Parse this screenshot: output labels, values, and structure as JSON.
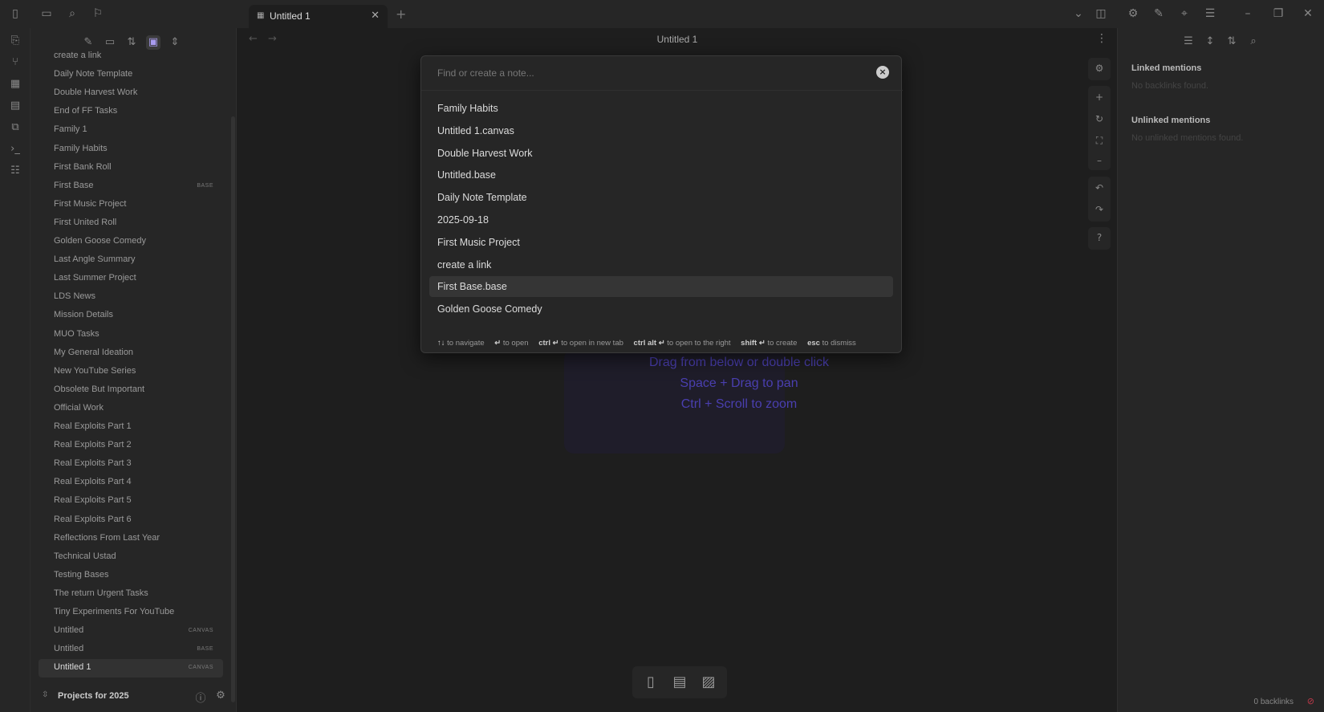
{
  "tabs": [
    {
      "title": "Untitled 1",
      "icon": "canvas-icon"
    }
  ],
  "view": {
    "title": "Untitled 1"
  },
  "explorer": {
    "files": [
      {
        "label": "create a link",
        "badge": ""
      },
      {
        "label": "Daily Note Template",
        "badge": ""
      },
      {
        "label": "Double Harvest Work",
        "badge": ""
      },
      {
        "label": "End of FF Tasks",
        "badge": ""
      },
      {
        "label": "Family 1",
        "badge": ""
      },
      {
        "label": "Family Habits",
        "badge": ""
      },
      {
        "label": "First Bank Roll",
        "badge": ""
      },
      {
        "label": "First Base",
        "badge": "BASE"
      },
      {
        "label": "First Music Project",
        "badge": ""
      },
      {
        "label": "First United Roll",
        "badge": ""
      },
      {
        "label": "Golden Goose Comedy",
        "badge": ""
      },
      {
        "label": "Last Angle Summary",
        "badge": ""
      },
      {
        "label": "Last Summer Project",
        "badge": ""
      },
      {
        "label": "LDS News",
        "badge": ""
      },
      {
        "label": "Mission Details",
        "badge": ""
      },
      {
        "label": "MUO Tasks",
        "badge": ""
      },
      {
        "label": "My General Ideation",
        "badge": ""
      },
      {
        "label": "New YouTube Series",
        "badge": ""
      },
      {
        "label": "Obsolete But Important",
        "badge": ""
      },
      {
        "label": "Official Work",
        "badge": ""
      },
      {
        "label": "Real Exploits Part 1",
        "badge": ""
      },
      {
        "label": "Real Exploits Part 2",
        "badge": ""
      },
      {
        "label": "Real Exploits Part 3",
        "badge": ""
      },
      {
        "label": "Real Exploits Part 4",
        "badge": ""
      },
      {
        "label": "Real Exploits Part 5",
        "badge": ""
      },
      {
        "label": "Real Exploits Part 6",
        "badge": ""
      },
      {
        "label": "Reflections From Last Year",
        "badge": ""
      },
      {
        "label": "Technical Ustad",
        "badge": ""
      },
      {
        "label": "Testing Bases",
        "badge": ""
      },
      {
        "label": "The return Urgent Tasks",
        "badge": ""
      },
      {
        "label": "Tiny Experiments For YouTube",
        "badge": ""
      },
      {
        "label": "Untitled",
        "badge": "CANVAS"
      },
      {
        "label": "Untitled",
        "badge": "BASE"
      },
      {
        "label": "Untitled 1",
        "badge": "CANVAS",
        "active": true
      }
    ],
    "vault_name": "Projects for 2025"
  },
  "canvas": {
    "hints": [
      "Drag from below or double click",
      "Space + Drag to pan",
      "Ctrl + Scroll to zoom"
    ]
  },
  "quick_switcher": {
    "placeholder": "Find or create a note...",
    "results": [
      "Family Habits",
      "Untitled 1.canvas",
      "Double Harvest Work",
      "Untitled.base",
      "Daily Note Template",
      "2025-09-18",
      "First Music Project",
      "create a link",
      "First Base.base",
      "Golden Goose Comedy"
    ],
    "selected_index": 8,
    "footer": {
      "navigate_keys": "↑↓",
      "navigate_text": "to navigate",
      "open_keys": "↵",
      "open_text": "to open",
      "newtab_keys": "ctrl ↵",
      "newtab_text": "to open in new tab",
      "right_keys": "ctrl alt ↵",
      "right_text": "to open to the right",
      "create_keys": "shift ↵",
      "create_text": "to create",
      "dismiss_keys": "esc",
      "dismiss_text": "to dismiss"
    }
  },
  "right_panel": {
    "linked_heading": "Linked mentions",
    "linked_empty": "No backlinks found.",
    "unlinked_heading": "Unlinked mentions",
    "unlinked_empty": "No unlinked mentions found.",
    "status": "0 backlinks"
  },
  "colors": {
    "accent": "#a99cf0",
    "hint": "#4a3fb0",
    "background": "#1e1e1e",
    "panel": "#262626"
  }
}
